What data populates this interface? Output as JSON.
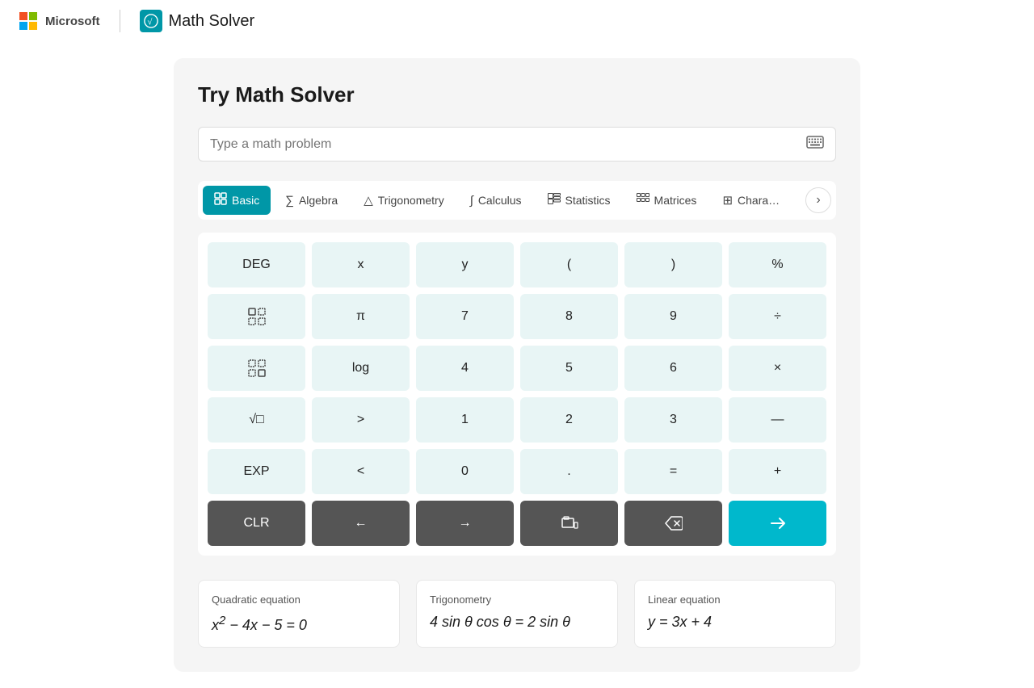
{
  "header": {
    "microsoft_text": "Microsoft",
    "app_name": "Math Solver",
    "app_icon_label": "√"
  },
  "main": {
    "title": "Try Math Solver",
    "search_placeholder": "Type a math problem"
  },
  "tabs": [
    {
      "id": "basic",
      "label": "Basic",
      "icon": "⊞",
      "active": true
    },
    {
      "id": "algebra",
      "label": "Algebra",
      "icon": "Σ",
      "active": false
    },
    {
      "id": "trigonometry",
      "label": "Trigonometry",
      "icon": "△",
      "active": false
    },
    {
      "id": "calculus",
      "label": "Calculus",
      "icon": "∫",
      "active": false
    },
    {
      "id": "statistics",
      "label": "Statistics",
      "icon": "▦",
      "active": false
    },
    {
      "id": "matrices",
      "label": "Matrices",
      "icon": "⊞",
      "active": false
    },
    {
      "id": "characters",
      "label": "Chara…",
      "icon": "⊞",
      "active": false
    }
  ],
  "calculator": {
    "rows": [
      [
        "DEG",
        "x",
        "y",
        "(",
        ")",
        "%"
      ],
      [
        "⊞",
        "π",
        "7",
        "8",
        "9",
        "÷"
      ],
      [
        "⊟",
        "log",
        "4",
        "5",
        "6",
        "×"
      ],
      [
        "√□",
        ">",
        "1",
        "2",
        "3",
        "—"
      ],
      [
        "EXP",
        "<",
        "0",
        ".",
        "=",
        "+"
      ]
    ],
    "action_row": [
      "CLR",
      "←",
      "→",
      "⊡",
      "⌫",
      "▶"
    ]
  },
  "examples": [
    {
      "label": "Quadratic equation",
      "formula": "x² − 4x − 5 = 0"
    },
    {
      "label": "Trigonometry",
      "formula": "4 sin θ cos θ = 2 sin θ"
    },
    {
      "label": "Linear equation",
      "formula": "y = 3x + 4"
    }
  ]
}
